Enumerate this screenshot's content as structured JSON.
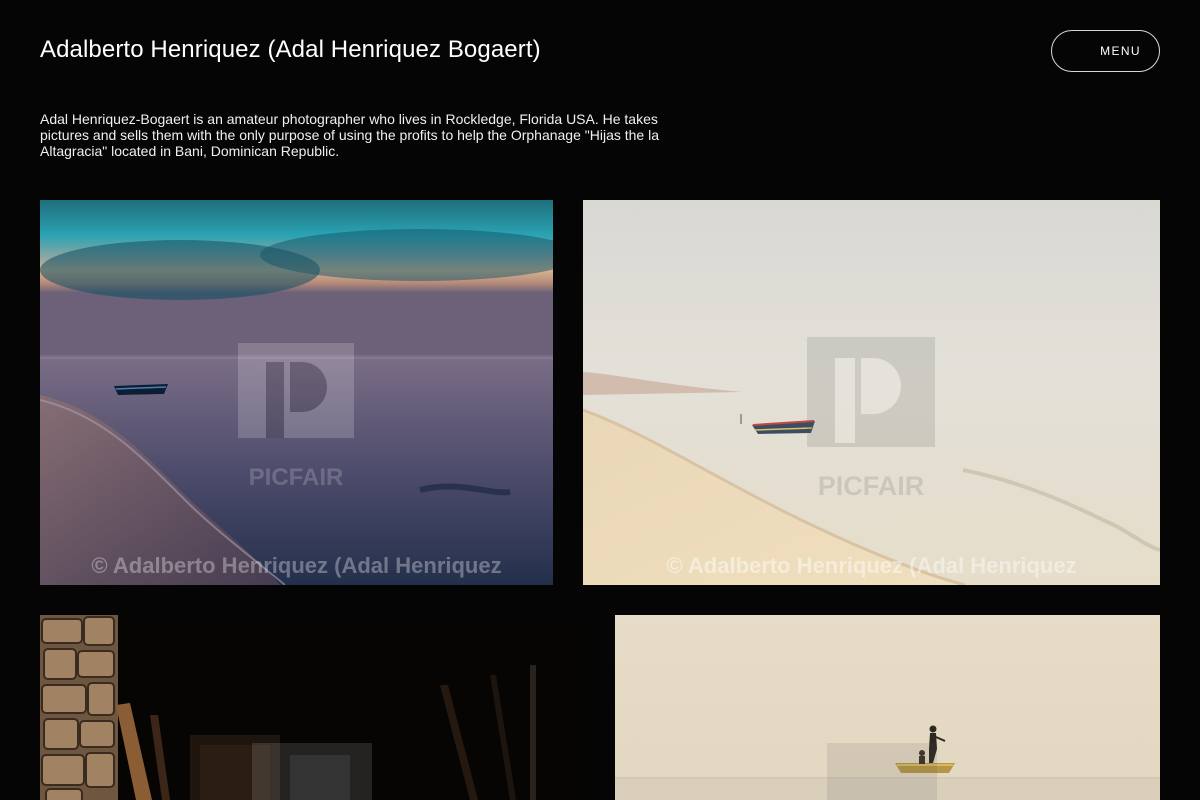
{
  "header": {
    "title": "Adalberto Henriquez (Adal Henriquez Bogaert)",
    "menu_label": "MENU"
  },
  "bio": {
    "text": "Adal Henriquez-Bogaert is an amateur photographer who lives in Rockledge, Florida USA. He takes pictures and sells them with the only purpose of using the profits to help the Orphanage \"Hijas the la Altagracia\" located in Bani, Dominican Republic."
  },
  "gallery": {
    "watermark": "PICFAIR",
    "photos": [
      {
        "subject": "boat on calm sea at dusk",
        "copyright": "© Adalberto Henriquez (Adal Henriquez"
      },
      {
        "subject": "boat on misty beach",
        "copyright": "© Adalberto Henriquez (Adal Henriquez"
      },
      {
        "subject": "dark stone interior",
        "copyright": ""
      },
      {
        "subject": "fisherman in boat on hazy sea",
        "copyright": ""
      }
    ]
  },
  "colors": {
    "background": "#050505",
    "text": "#ffffff",
    "menu_border": "#d8d8d8"
  }
}
